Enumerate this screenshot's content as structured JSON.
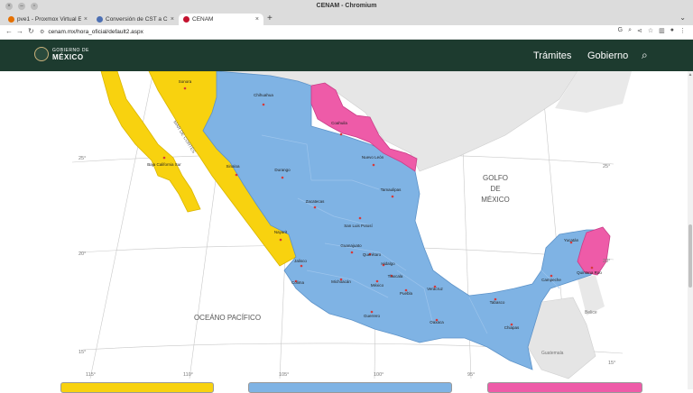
{
  "window": {
    "title": "CENAM - Chromium"
  },
  "tabs": [
    {
      "label": "pve1 - Proxmox Virtual E",
      "favicon_color": "#e57000",
      "active": false
    },
    {
      "label": "Conversión de CST a CDT",
      "favicon_color": "#4c6fb3",
      "active": false
    },
    {
      "label": "CENAM",
      "favicon_color": "#c4122f",
      "active": true
    }
  ],
  "address": {
    "url": "cenam.mx/hora_oficial/default2.aspx"
  },
  "site": {
    "logo_top": "GOBIERNO DE",
    "logo_bottom": "MÉXICO",
    "nav": [
      "Trámites",
      "Gobierno"
    ]
  },
  "colors": {
    "header": "#1d3b2f",
    "zone_pacific": "#f8d20f",
    "zone_central": "#7fb3e4",
    "zone_northwest": "#ee5ba8",
    "sea": "#ffffff",
    "land_other": "#e4e4e4"
  },
  "map": {
    "labels": {
      "ocean": "OCEÁNO PACÍFICO",
      "gulf_1": "GOLFO",
      "gulf_2": "DE",
      "gulf_3": "MÉXICO",
      "sea_cortes": "MAR DE CORTÉS",
      "belice": "Belice",
      "guatemala": "Guatemala"
    },
    "lat_ticks": [
      "25°",
      "20°",
      "15°"
    ],
    "lon_ticks": [
      "115°",
      "110°",
      "105°",
      "100°",
      "95°"
    ],
    "states": [
      "Sonora",
      "Chihuahua",
      "Coahuila",
      "Nuevo León",
      "Tamaulipas",
      "Baja California Sur",
      "Sinaloa",
      "Durango",
      "Zacatecas",
      "San Luis Potosí",
      "Nayarit",
      "Jalisco",
      "Guanajuato",
      "Querétaro",
      "Hidalgo",
      "Colima",
      "Michoacán",
      "México",
      "Puebla",
      "Veracruz",
      "Tlaxcala",
      "Guerrero",
      "Oaxaca",
      "Tabasco",
      "Chiapas",
      "Campeche",
      "Yucatán",
      "Quintana Roo"
    ]
  }
}
